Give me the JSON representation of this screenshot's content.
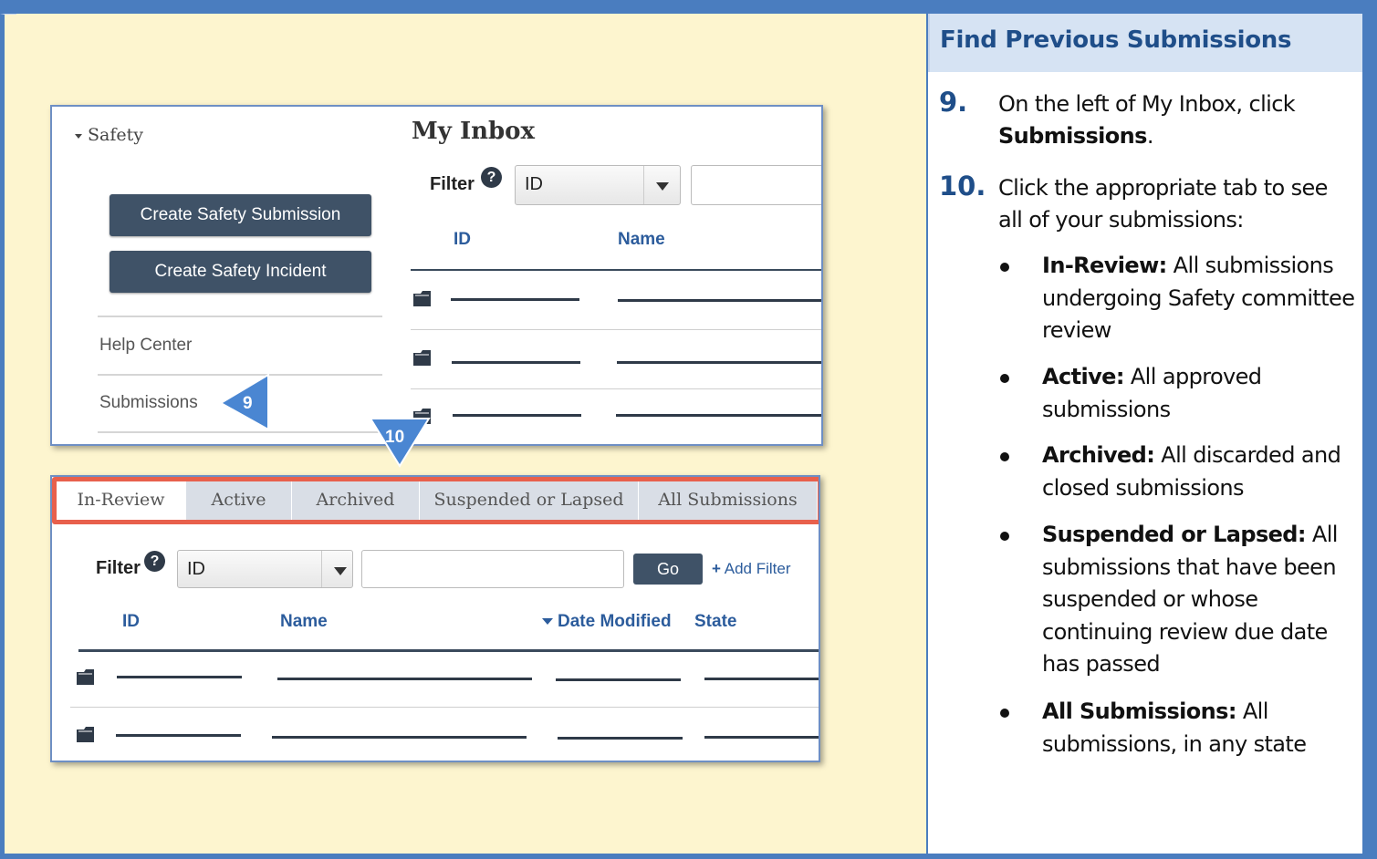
{
  "panel": {
    "title": "Find Previous Submissions",
    "steps": [
      {
        "number": "9.",
        "text_before": "On the left of My Inbox, click ",
        "bold": "Submissions",
        "text_after": "."
      },
      {
        "number": "10.",
        "text": "Click the appropriate tab to see all of your submissions:"
      }
    ],
    "bullets": [
      {
        "term": "In-Review:",
        "desc": " All submissions undergoing Safety committee review"
      },
      {
        "term": "Active:",
        "desc": " All approved submissions"
      },
      {
        "term": "Archived:",
        "desc": " All discarded and closed submissions"
      },
      {
        "term": "Suspended or Lapsed:",
        "desc": " All submissions that have been suspended or whose continuing review due date has passed"
      },
      {
        "term": "All Submissions:",
        "desc": " All submissions, in any state"
      }
    ]
  },
  "inbox": {
    "section_label": "Safety",
    "create_submission_label": "Create Safety Submission",
    "create_incident_label": "Create Safety Incident",
    "help_center_label": "Help Center",
    "submissions_label": "Submissions",
    "title": "My Inbox",
    "filter_label": "Filter",
    "filter_select_value": "ID",
    "columns": [
      "ID",
      "Name"
    ],
    "callout_9": "9",
    "callout_10": "10"
  },
  "submissions": {
    "tabs": [
      "In-Review",
      "Active",
      "Archived",
      "Suspended or Lapsed",
      "All Submissions"
    ],
    "filter_label": "Filter",
    "filter_select_value": "ID",
    "go_label": "Go",
    "add_filter_label": "Add Filter",
    "add_filter_prefix": "+",
    "columns": [
      "ID",
      "Name",
      "Date Modified",
      "State"
    ]
  },
  "colors": {
    "frame": "#4a7dbf",
    "left_background": "#fdf5cf",
    "header_background": "#d6e3f3",
    "title_text": "#1f4e89",
    "dark_button": "#3f5267",
    "tab_highlight_border": "#e8604c",
    "callout_fill": "#4a86d2"
  },
  "icons": [
    "help-icon",
    "document-icon",
    "dropdown-arrow-icon",
    "plus-icon",
    "callout-arrow-icon"
  ]
}
